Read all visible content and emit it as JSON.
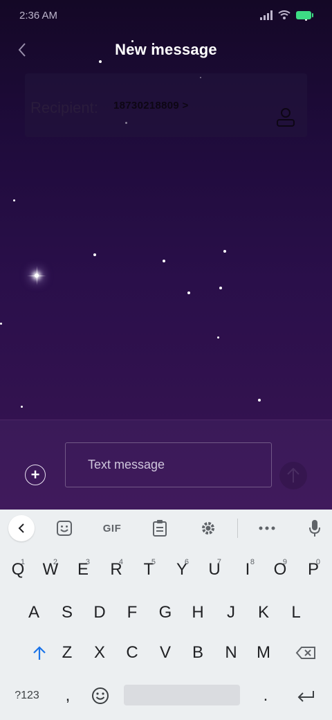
{
  "status_bar": {
    "time": "2:36 AM"
  },
  "header": {
    "title": "New message"
  },
  "recipient": {
    "label": "Recipient:",
    "value": "18730218809 >"
  },
  "compose": {
    "placeholder": "Text message"
  },
  "keyboard": {
    "toolbar": {
      "gif_label": "GIF"
    },
    "row1": [
      {
        "label": "Q",
        "hint": "1"
      },
      {
        "label": "W",
        "hint": "2"
      },
      {
        "label": "E",
        "hint": "3"
      },
      {
        "label": "R",
        "hint": "4"
      },
      {
        "label": "T",
        "hint": "5"
      },
      {
        "label": "Y",
        "hint": "6"
      },
      {
        "label": "U",
        "hint": "7"
      },
      {
        "label": "I",
        "hint": "8"
      },
      {
        "label": "O",
        "hint": "9"
      },
      {
        "label": "P",
        "hint": "0"
      }
    ],
    "row2": [
      "A",
      "S",
      "D",
      "F",
      "G",
      "H",
      "J",
      "K",
      "L"
    ],
    "row3": [
      "Z",
      "X",
      "C",
      "V",
      "B",
      "N",
      "M"
    ],
    "bottom": {
      "symbols_label": "?123",
      "comma_label": ",",
      "period_label": "."
    }
  },
  "colors": {
    "accent_blue": "#1a73e8",
    "battery_green": "#3ddc84",
    "keyboard_bg": "#eceff1"
  }
}
